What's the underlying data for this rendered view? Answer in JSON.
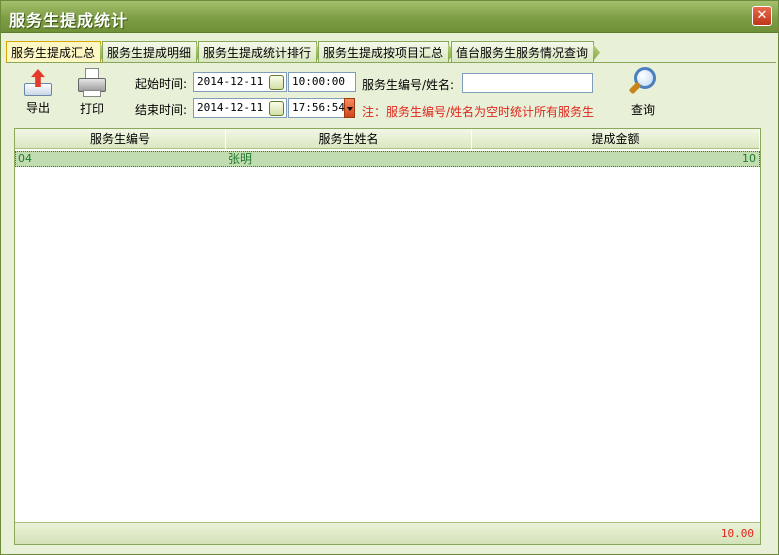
{
  "window": {
    "title": "服务生提成统计",
    "close_glyph": "✕"
  },
  "tabs": [
    {
      "label": "服务生提成汇总",
      "active": true
    },
    {
      "label": "服务生提成明细",
      "active": false
    },
    {
      "label": "服务生提成统计排行",
      "active": false
    },
    {
      "label": "服务生提成按项目汇总",
      "active": false
    },
    {
      "label": "值台服务生服务情况查询",
      "active": false
    }
  ],
  "toolbar": {
    "export_label": "导出",
    "print_label": "打印",
    "query_label": "查询",
    "start_label": "起始时间:",
    "end_label": "结束时间:",
    "start_date": "2014-12-11",
    "start_time": "10:00:00",
    "end_date": "2014-12-11",
    "end_time": "17:56:54",
    "waiter_label": "服务生编号/姓名:",
    "waiter_value": "",
    "note": "注：服务生编号/姓名为空时统计所有服务生"
  },
  "table": {
    "columns": [
      "服务生编号",
      "服务生姓名",
      "提成金额"
    ],
    "rows": [
      {
        "id": "04",
        "name": "张明",
        "amount": "10"
      }
    ],
    "total": "10.00"
  },
  "colors": {
    "accent": "#7d9e45",
    "note": "#e0261b",
    "row_selected": "#c2dcb1"
  }
}
